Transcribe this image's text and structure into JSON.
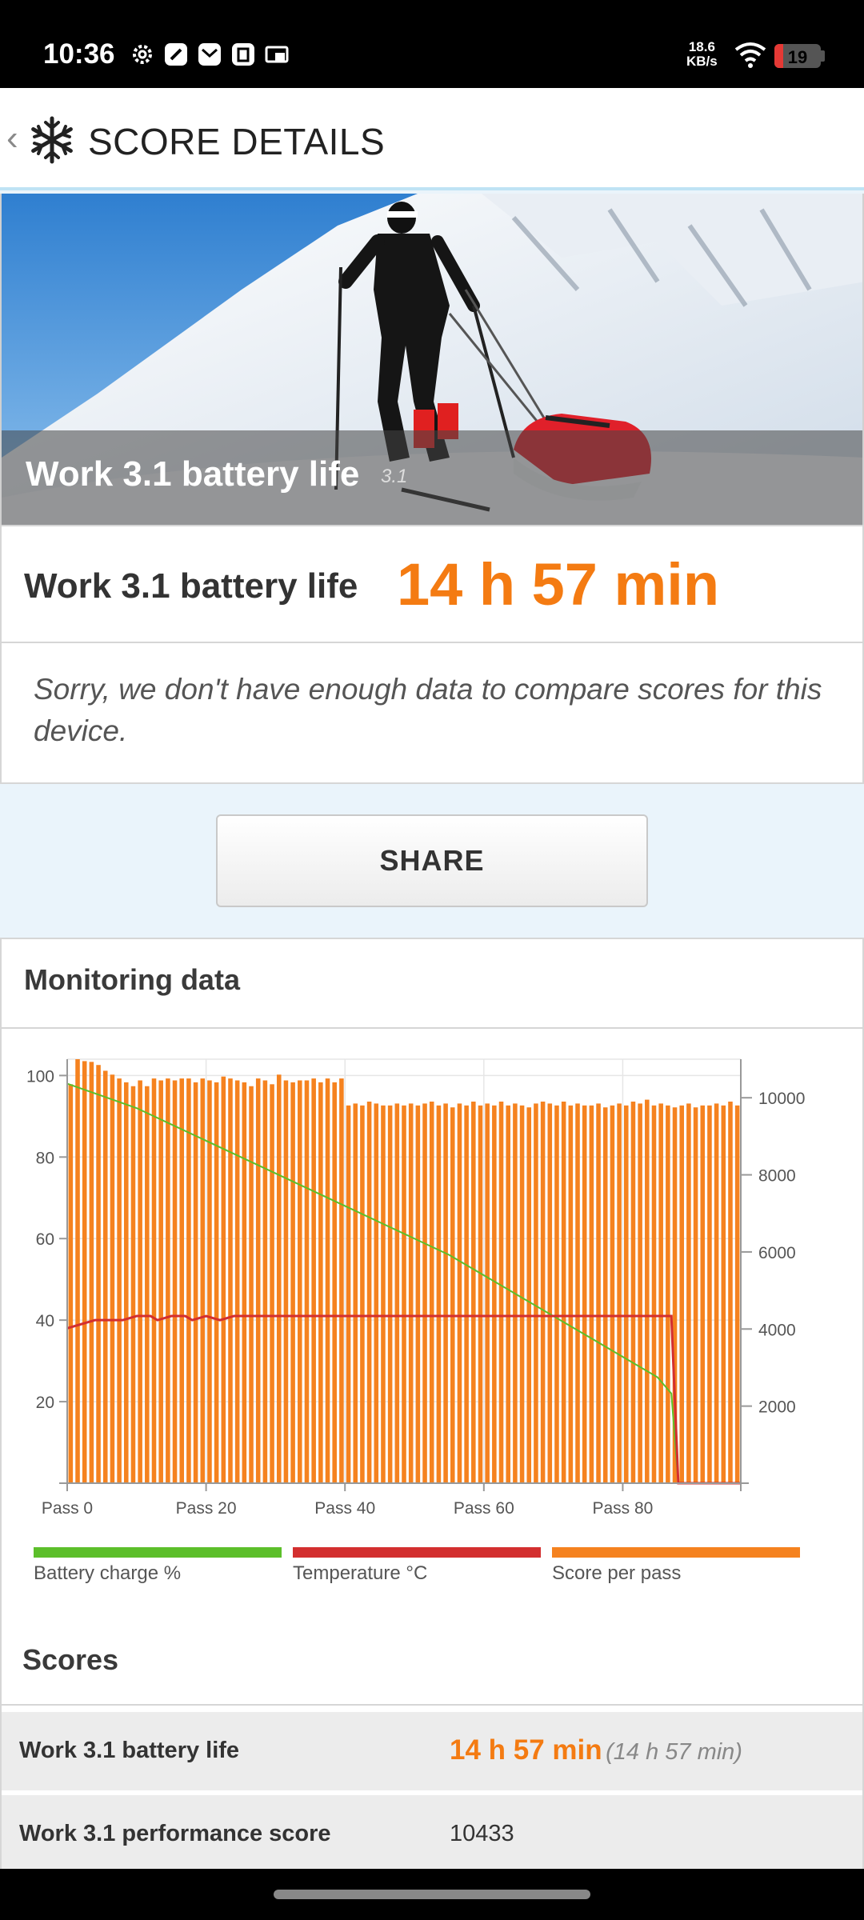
{
  "status_bar": {
    "time": "10:36",
    "net_speed_value": "18.6",
    "net_speed_unit": "KB/s",
    "battery_level": "19",
    "battery_fraction": 0.19,
    "icons": [
      "settings-icon",
      "compass-app-icon",
      "mail-app-icon",
      "clipboard-app-icon",
      "cast-icon"
    ]
  },
  "app_bar": {
    "title": "SCORE DETAILS",
    "logo": "snowflake-icon"
  },
  "hero": {
    "title": "Work 3.1 battery life",
    "version": "3.1"
  },
  "result": {
    "label": "Work 3.1 battery life",
    "value": "14 h 57 min",
    "value_color": "#f47b12"
  },
  "note": "Sorry, we don't have enough data to compare scores for this device.",
  "share_label": "SHARE",
  "monitoring": {
    "title": "Monitoring data",
    "legend": [
      {
        "label": "Battery charge %",
        "color": "#5cbf2a"
      },
      {
        "label": "Temperature °C",
        "color": "#d32f2f"
      },
      {
        "label": "Score per pass",
        "color": "#f5821f"
      }
    ]
  },
  "chart_data": {
    "type": "bar",
    "x_tick_labels": [
      "Pass 0",
      "Pass 20",
      "Pass 40",
      "Pass 60",
      "Pass 80"
    ],
    "x_ticks": [
      0,
      20,
      40,
      60,
      80
    ],
    "x_range": [
      0,
      97
    ],
    "left_axis": {
      "ticks": [
        20,
        40,
        60,
        80,
        100
      ],
      "range": [
        0,
        104
      ]
    },
    "right_axis": {
      "ticks": [
        2000,
        4000,
        6000,
        8000,
        10000
      ],
      "range": [
        0,
        11000
      ]
    },
    "grid": true,
    "series": [
      {
        "name": "Score per pass",
        "axis": "right",
        "type": "bar",
        "values": [
          10350,
          11000,
          10950,
          10930,
          10850,
          10700,
          10600,
          10500,
          10400,
          10300,
          10450,
          10300,
          10500,
          10450,
          10500,
          10450,
          10500,
          10500,
          10400,
          10500,
          10450,
          10400,
          10550,
          10500,
          10450,
          10400,
          10300,
          10500,
          10450,
          10350,
          10600,
          10450,
          10400,
          10450,
          10450,
          10500,
          10400,
          10500,
          10400,
          10500,
          9800,
          9850,
          9800,
          9900,
          9850,
          9800,
          9800,
          9850,
          9800,
          9850,
          9800,
          9850,
          9900,
          9800,
          9850,
          9750,
          9850,
          9800,
          9900,
          9800,
          9850,
          9800,
          9900,
          9800,
          9850,
          9800,
          9750,
          9850,
          9900,
          9850,
          9800,
          9900,
          9800,
          9850,
          9800,
          9800,
          9850,
          9750,
          9800,
          9850,
          9800,
          9900,
          9850,
          9950,
          9800,
          9850,
          9800,
          9750,
          9800,
          9850,
          9750,
          9800,
          9800,
          9850,
          9800,
          9900,
          9800
        ]
      },
      {
        "name": "Battery charge %",
        "axis": "left",
        "type": "line",
        "x": [
          0,
          5,
          10,
          15,
          20,
          25,
          30,
          35,
          40,
          45,
          50,
          55,
          60,
          65,
          70,
          75,
          80,
          85,
          87,
          88
        ],
        "values": [
          98,
          95,
          92,
          88,
          84,
          80,
          76,
          72,
          68,
          64,
          60,
          56,
          51,
          46,
          41,
          36,
          31,
          26,
          22,
          0
        ]
      },
      {
        "name": "Temperature °C",
        "axis": "left",
        "type": "line",
        "x": [
          0,
          2,
          3,
          4,
          8,
          10,
          12,
          13,
          15,
          17,
          18,
          20,
          22,
          24,
          87,
          88,
          97
        ],
        "values": [
          38,
          39,
          39.5,
          40,
          40,
          41,
          41,
          40,
          41,
          41,
          40,
          41,
          40,
          41,
          41,
          0,
          0
        ]
      }
    ]
  },
  "scores": {
    "title": "Scores",
    "rows": [
      {
        "label": "Work 3.1 battery life",
        "value": "14 h 57 min",
        "secondary": "(14 h 57 min)"
      },
      {
        "label": "Work 3.1 performance score",
        "value": "10433"
      }
    ]
  }
}
